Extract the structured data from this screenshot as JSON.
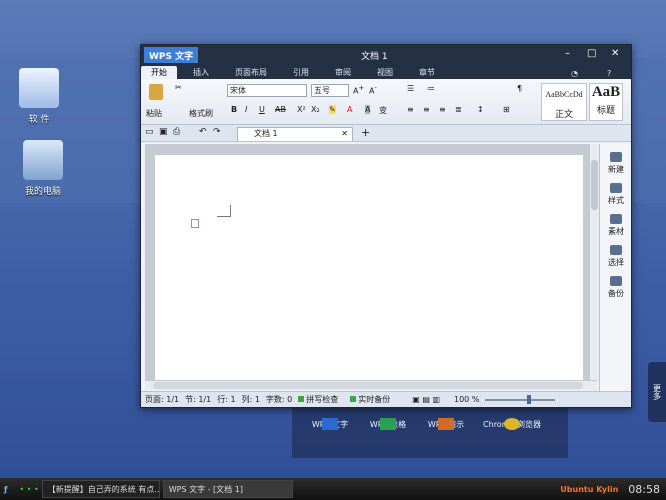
{
  "desktop": {
    "icons": [
      {
        "label": "软 件"
      },
      {
        "label": "我的电脑"
      }
    ]
  },
  "dock": {
    "items": [
      {
        "label": "WPS 文字",
        "color": "#2b6fd6"
      },
      {
        "label": "WPS 表格",
        "color": "#2aa84a"
      },
      {
        "label": "WPS 演示",
        "color": "#e07020"
      },
      {
        "label": "Chrome 浏览器",
        "color": "#e8c020"
      }
    ]
  },
  "taskbar": {
    "task1": "【新提醒】自己弄的系统 有点...",
    "task2": "WPS 文字 - [文档 1]",
    "clock": "08:58",
    "brand": "Ubuntu Kylin"
  },
  "side_tab": "更多",
  "window": {
    "app_button": "WPS 文字",
    "doc_title": "文档 1",
    "tabs": [
      {
        "label": "开始"
      },
      {
        "label": "插入"
      },
      {
        "label": "页面布局"
      },
      {
        "label": "引用"
      },
      {
        "label": "审阅"
      },
      {
        "label": "视图"
      },
      {
        "label": "章节"
      }
    ],
    "ribbon": {
      "paste": "粘贴",
      "format_painter": "格式刷",
      "font": "宋体",
      "size": "五号",
      "style_normal": "正文",
      "style_normal_preview": "AaBbCcDd",
      "style_h1": "标题",
      "style_h1_preview": "AaB"
    },
    "doc_tab": "文档 1",
    "taskpane": [
      {
        "label": "新建"
      },
      {
        "label": "样式"
      },
      {
        "label": "素材"
      },
      {
        "label": "选择"
      },
      {
        "label": "备份"
      }
    ],
    "status": {
      "page": "页面: 1/1",
      "section": "节: 1/1",
      "row": "行: 1",
      "col": "列: 1",
      "chars": "字数: 0",
      "spell": "拼写检查",
      "backup": "实时备份",
      "zoom": "100 %"
    }
  }
}
